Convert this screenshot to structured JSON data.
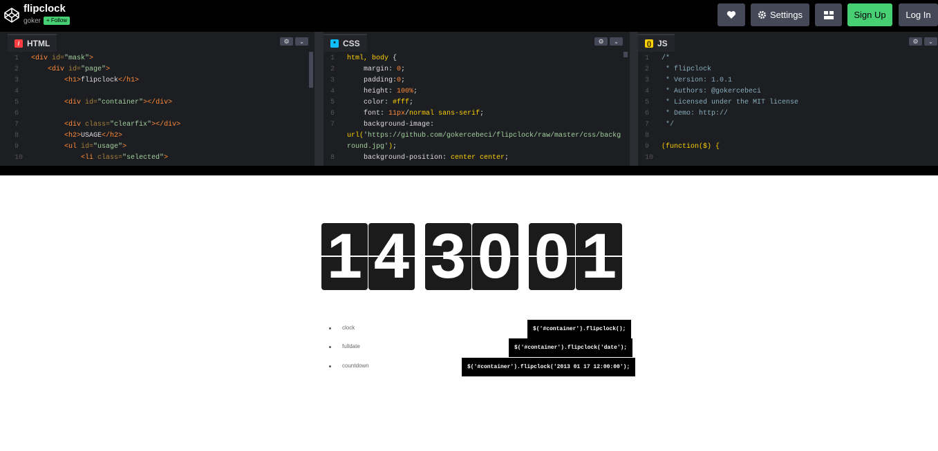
{
  "header": {
    "title": "flipclock",
    "author": "goker",
    "follow_label": "+ Follow",
    "buttons": {
      "settings": "Settings",
      "signup": "Sign Up",
      "login": "Log In"
    }
  },
  "editors": {
    "html": {
      "tab_label": "HTML",
      "lines": [
        {
          "n": "1",
          "code": "<div id=\"mask\">"
        },
        {
          "n": "2",
          "code": "    <div id=\"page\">"
        },
        {
          "n": "3",
          "code": "        <h1>flipclock</h1>"
        },
        {
          "n": "4",
          "code": ""
        },
        {
          "n": "5",
          "code": "        <div id=\"container\"></div>"
        },
        {
          "n": "6",
          "code": ""
        },
        {
          "n": "7",
          "code": "        <div class=\"clearfix\"></div>"
        },
        {
          "n": "8",
          "code": "        <h2>USAGE</h2>"
        },
        {
          "n": "9",
          "code": "        <ul id=\"usage\">"
        },
        {
          "n": "10",
          "code": "            <li class=\"selected\">"
        }
      ]
    },
    "css": {
      "tab_label": "CSS",
      "lines": [
        {
          "n": "1",
          "code": "html, body {"
        },
        {
          "n": "2",
          "code": "    margin: 0;"
        },
        {
          "n": "3",
          "code": "    padding:0;"
        },
        {
          "n": "4",
          "code": "    height: 100%;"
        },
        {
          "n": "5",
          "code": "    color: #fff;"
        },
        {
          "n": "6",
          "code": "    font: 11px/normal sans-serif;"
        },
        {
          "n": "7",
          "code": "    background-image:"
        },
        {
          "n": "",
          "code": "url('https://github.com/gokercebeci/flipclock/raw/master/css/backg"
        },
        {
          "n": "",
          "code": "round.jpg');"
        },
        {
          "n": "8",
          "code": "    background-position: center center;"
        }
      ]
    },
    "js": {
      "tab_label": "JS",
      "lines": [
        {
          "n": "1",
          "code": "/*"
        },
        {
          "n": "2",
          "code": " * flipclock"
        },
        {
          "n": "3",
          "code": " * Version: 1.0.1"
        },
        {
          "n": "4",
          "code": " * Authors: @gokercebeci"
        },
        {
          "n": "5",
          "code": " * Licensed under the MIT license"
        },
        {
          "n": "6",
          "code": " * Demo: http://"
        },
        {
          "n": "7",
          "code": " */"
        },
        {
          "n": "8",
          "code": ""
        },
        {
          "n": "9",
          "code": "(function($) {"
        },
        {
          "n": "10",
          "code": ""
        }
      ]
    }
  },
  "preview": {
    "digits": [
      "1",
      "4",
      "3",
      "0",
      "0",
      "1"
    ],
    "usage": [
      {
        "label": "clock",
        "code": "$('#container').flipclock();"
      },
      {
        "label": "fulldate",
        "code": "$('#container').flipclock('date');"
      },
      {
        "label": "countdown",
        "code": "$('#container').flipclock('2013 01 17 12:00:00');"
      }
    ]
  },
  "colors": {
    "accent_green": "#47cf73",
    "button_bg": "#444857",
    "editor_bg": "#1d1e22",
    "html_icon": "#ff3c41",
    "css_icon": "#0ebeff",
    "js_icon": "#fcd000"
  },
  "icons": {
    "logo": "codepen-cube-icon",
    "heart": "heart-icon",
    "settings": "gear-icon",
    "layout": "grid-layout-icon"
  }
}
